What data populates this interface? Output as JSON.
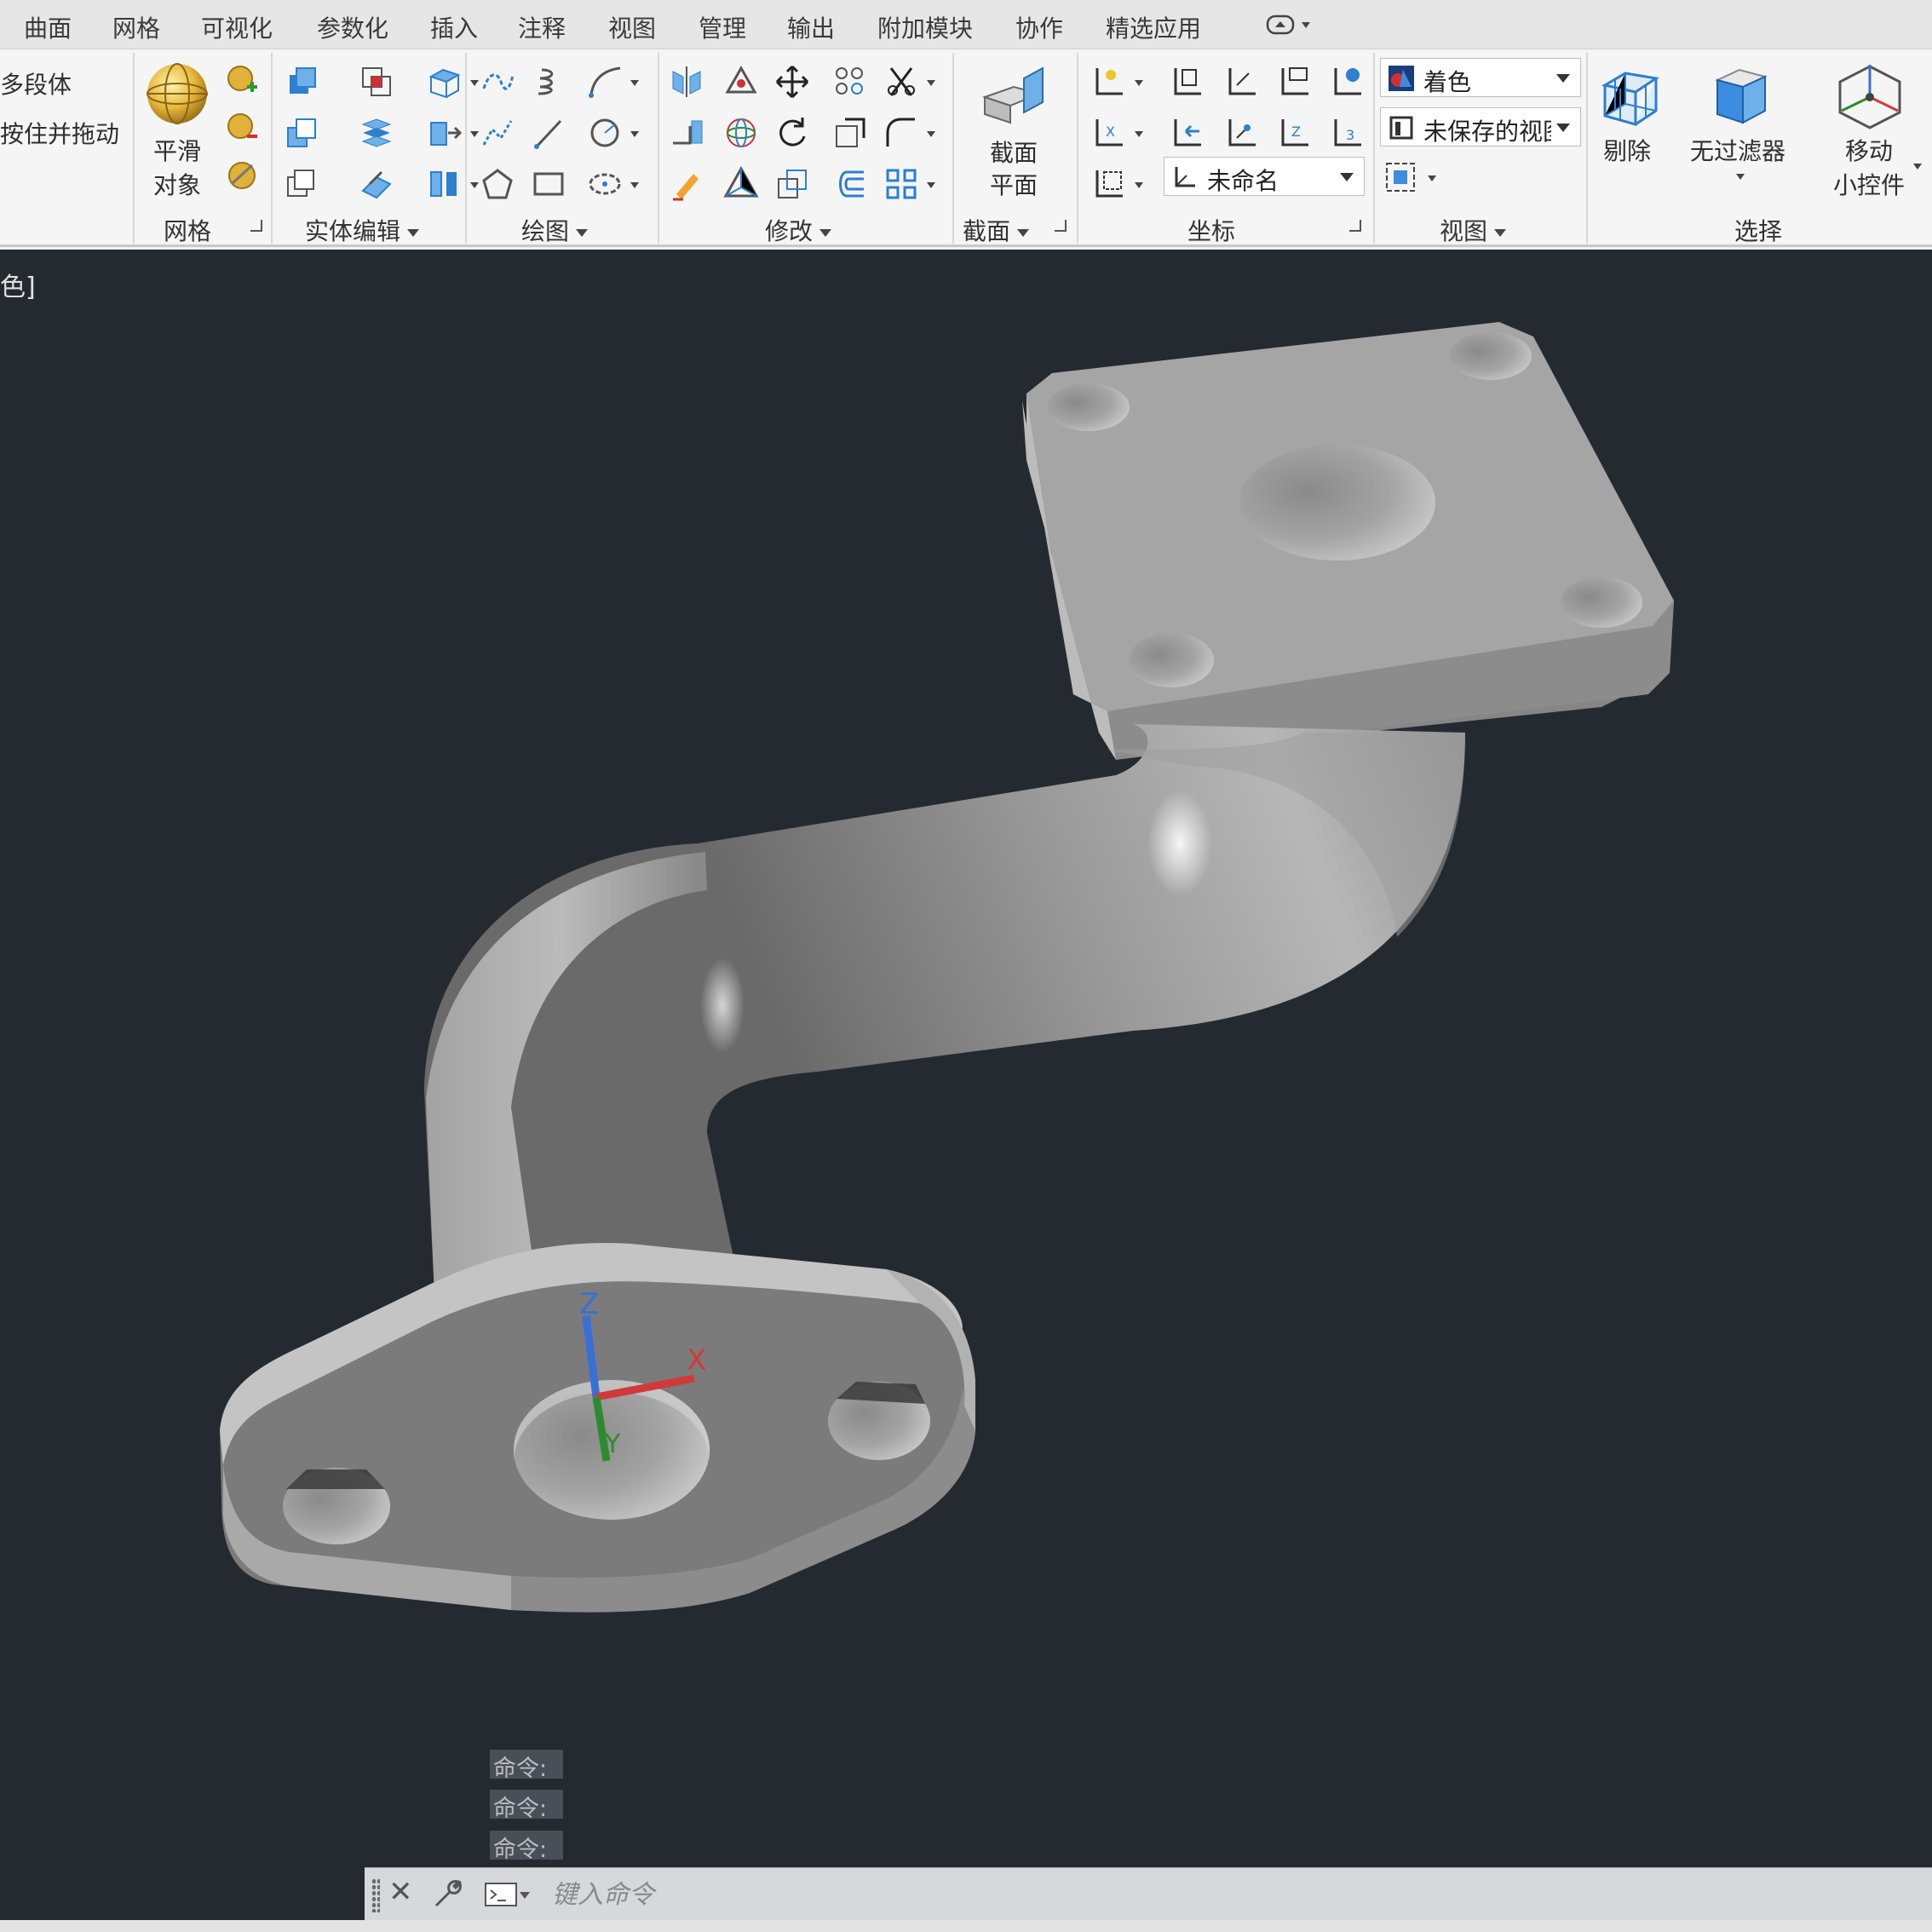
{
  "tabs": [
    "曲面",
    "网格",
    "可视化",
    "参数化",
    "插入",
    "注释",
    "视图",
    "管理",
    "输出",
    "附加模块",
    "协作",
    "精选应用"
  ],
  "ribbon": {
    "partial_left": {
      "line1": "多段体",
      "line2": "按住并拖动"
    },
    "mesh": {
      "smooth_line1": "平滑",
      "smooth_line2": "对象",
      "title": "网格"
    },
    "solid_edit": {
      "title": "实体编辑"
    },
    "draw": {
      "title": "绘图"
    },
    "modify": {
      "title": "修改"
    },
    "section": {
      "plane_line1": "截面",
      "plane_line2": "平面",
      "title": "截面"
    },
    "coords": {
      "ucs_combo": "未命名",
      "title": "坐标"
    },
    "view": {
      "visual_style": "着色",
      "named_view": "未保存的视图",
      "title": "视图"
    },
    "selection": {
      "cull": "剔除",
      "filter": "无过滤器",
      "gizmo_line1": "移动",
      "gizmo_line2": "小控件",
      "title": "选择"
    }
  },
  "viewport": {
    "label": "色]",
    "ucs_axes": {
      "x": "X",
      "y": "Y",
      "z": "Z"
    }
  },
  "command": {
    "history": [
      "命令:",
      "命令:",
      "命令:"
    ],
    "placeholder": "键入命令"
  },
  "colors": {
    "viewport_bg": "#252a31",
    "model_gray": "#a8a8a8",
    "axis_x": "#d23a3a",
    "axis_y": "#2f8a2f",
    "axis_z": "#3a6fd8"
  }
}
